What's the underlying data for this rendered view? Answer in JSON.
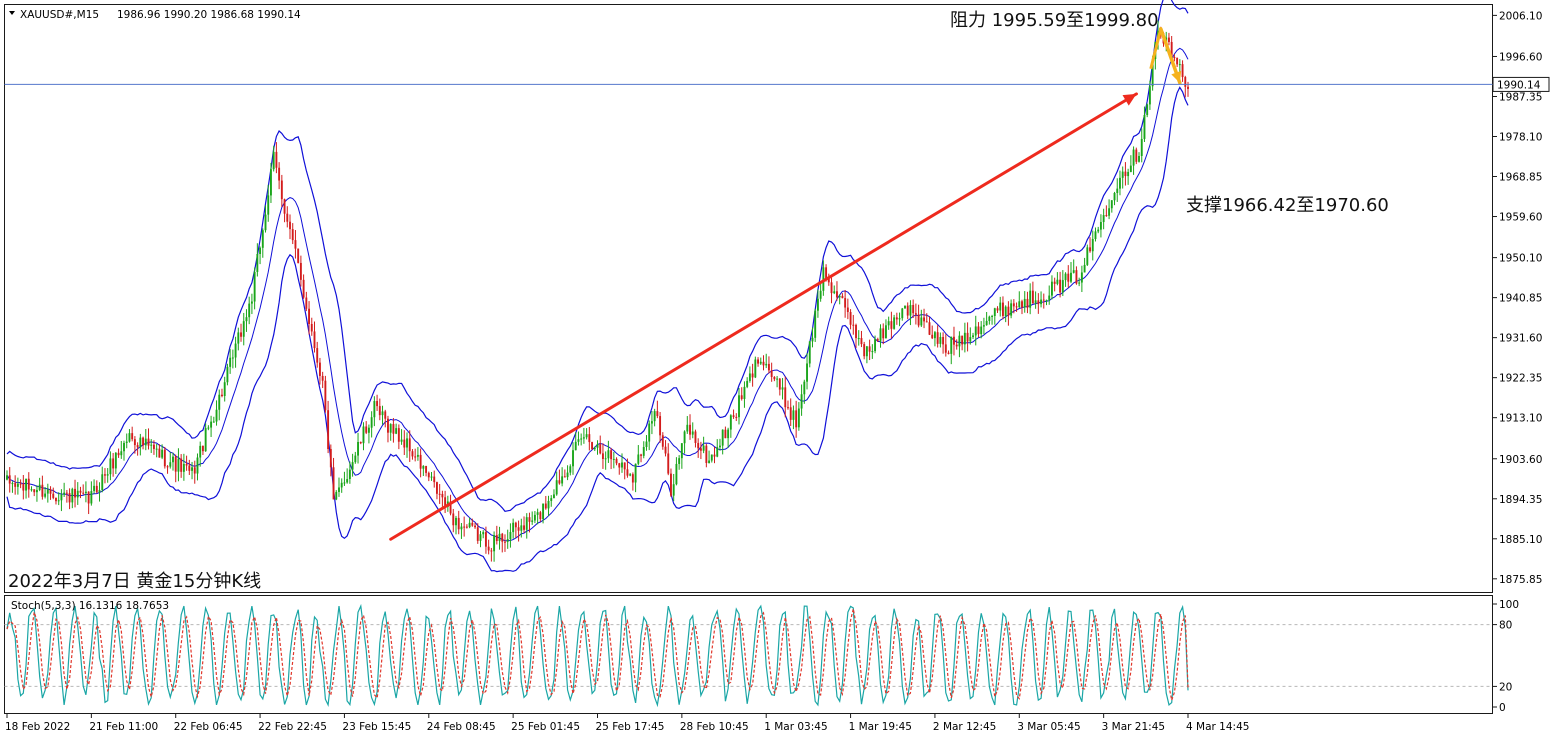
{
  "symbol_header": {
    "symbol": "XAUUSD#,M15",
    "ohlc": "1986.96 1990.20 1986.68 1990.14"
  },
  "annotations": {
    "resistance": "阻力 1995.59至1999.80",
    "support": "支撑1966.42至1970.60",
    "caption": "2022年3月7日 黄金15分钟K线"
  },
  "current_price_label": "1990.14",
  "stoch_header": "Stoch(5,3,3) 16.1316 18.7653",
  "colors": {
    "bands": "#1010d8",
    "trend_arrow": "#ee2a1e",
    "down_arrow": "#f5b21d",
    "candle_up": "#1aa51a",
    "candle_down": "#d31c1c",
    "stoch_main": "#1aa6a6",
    "stoch_signal": "#e0362a",
    "border": "#1a1a1a",
    "grid_level": "#b8b8b8"
  },
  "chart_data": [
    {
      "type": "candlestick",
      "title": "",
      "price_axis": {
        "ticks": [
          "2006.10",
          "1996.60",
          "1987.35",
          "1978.10",
          "1968.85",
          "1959.60",
          "1950.10",
          "1940.85",
          "1931.60",
          "1922.35",
          "1913.10",
          "1903.60",
          "1894.35",
          "1885.10",
          "1875.85"
        ],
        "tick_values": [
          2006.1,
          1996.6,
          1987.35,
          1978.1,
          1968.85,
          1959.6,
          1950.1,
          1940.85,
          1931.6,
          1922.35,
          1913.1,
          1903.6,
          1894.35,
          1885.1,
          1875.85
        ],
        "ylim": [
          1872.8,
          2008.5
        ]
      },
      "time_axis": {
        "ticks": [
          "18 Feb 2022",
          "21 Feb 11:00",
          "22 Feb 06:45",
          "22 Feb 22:45",
          "23 Feb 15:45",
          "24 Feb 08:45",
          "25 Feb 01:45",
          "25 Feb 17:45",
          "28 Feb 10:45",
          "1 Mar 03:45",
          "1 Mar 19:45",
          "2 Mar 12:45",
          "3 Mar 05:45",
          "3 Mar 21:45",
          "4 Mar 14:45"
        ]
      },
      "price_path": {
        "bars": [
          0,
          30,
          45,
          55,
          68,
          80,
          90,
          98,
          108,
          116,
          120,
          135,
          148,
          165,
          178,
          195,
          212,
          230,
          238,
          244,
          250,
          258,
          266,
          277,
          290,
          300,
          306,
          316,
          330,
          345,
          365,
          378,
          394,
          408,
          416,
          423,
          434
        ],
        "close": [
          1898,
          1894,
          1909,
          1905,
          1900,
          1921,
          1941,
          1973,
          1945,
          1921,
          1893,
          1915,
          1906,
          1889,
          1884,
          1890,
          1909,
          1900,
          1915,
          1897,
          1911,
          1903,
          1912,
          1928,
          1912,
          1947,
          1940,
          1928,
          1939,
          1929,
          1938,
          1941,
          1946,
          1968,
          1975,
          2003,
          1990
        ]
      },
      "bars_total": 435,
      "last_price": 1990.14,
      "bands_offset": 9,
      "trendline": {
        "from_bar": 141,
        "from_price": 1885.0,
        "to_bar": 334,
        "to_price": 1957.5
      },
      "down_arrow": {
        "from_bar": 424,
        "from_price": 2003.0,
        "to_bar": 431,
        "to_price": 1990.5
      }
    },
    {
      "type": "line",
      "title": "",
      "indicator": "Stoch(5,3,3)",
      "ylim": [
        0,
        100
      ],
      "levels": [
        20,
        80
      ],
      "axis_ticks": [
        "100",
        "80",
        "20",
        "0"
      ],
      "axis_tick_values": [
        100,
        80,
        20,
        0
      ],
      "series": [
        {
          "name": "",
          "period": 5,
          "last": 16.1316
        },
        {
          "name": "",
          "period": 3,
          "last": 18.7653
        }
      ]
    }
  ]
}
